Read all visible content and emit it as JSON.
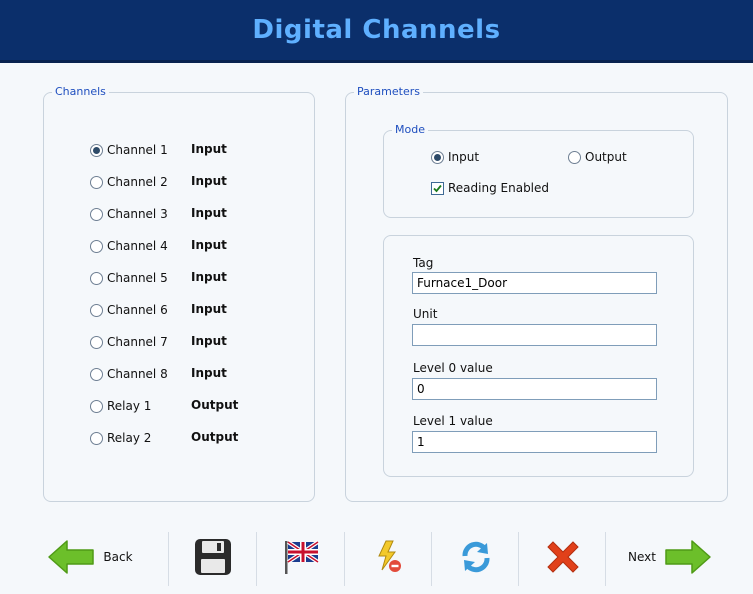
{
  "window": {
    "title": "Digital Channels"
  },
  "channels": {
    "legend": "Channels",
    "items": [
      {
        "label": "Channel 1",
        "type": "Input",
        "selected": true
      },
      {
        "label": "Channel 2",
        "type": "Input",
        "selected": false
      },
      {
        "label": "Channel 3",
        "type": "Input",
        "selected": false
      },
      {
        "label": "Channel 4",
        "type": "Input",
        "selected": false
      },
      {
        "label": "Channel 5",
        "type": "Input",
        "selected": false
      },
      {
        "label": "Channel 6",
        "type": "Input",
        "selected": false
      },
      {
        "label": "Channel 7",
        "type": "Input",
        "selected": false
      },
      {
        "label": "Channel 8",
        "type": "Input",
        "selected": false
      },
      {
        "label": "Relay 1",
        "type": "Output",
        "selected": false
      },
      {
        "label": "Relay 2",
        "type": "Output",
        "selected": false
      }
    ]
  },
  "parameters": {
    "legend": "Parameters",
    "mode": {
      "legend": "Mode",
      "input_label": "Input",
      "output_label": "Output",
      "selected": "Input",
      "reading_enabled_label": "Reading Enabled",
      "reading_enabled": true
    },
    "fields": {
      "tag": {
        "label": "Tag",
        "value": "Furnace1_Door"
      },
      "unit": {
        "label": "Unit",
        "value": ""
      },
      "level0": {
        "label": "Level 0 value",
        "value": "0"
      },
      "level1": {
        "label": "Level 1 value",
        "value": "1"
      }
    }
  },
  "toolbar": {
    "back_label": "Back",
    "next_label": "Next",
    "icons": [
      "back-arrow-icon",
      "save-icon",
      "language-flag-icon",
      "energy-lightning-icon",
      "refresh-icon",
      "delete-icon",
      "next-arrow-icon"
    ]
  },
  "colors": {
    "header_bg": "#0b2f6b",
    "header_text": "#5fb0ff",
    "legend_text": "#1f4fbf",
    "arrow_green": "#6cbf2a",
    "delete_red": "#e1401a",
    "refresh_blue": "#3a9ad9"
  }
}
